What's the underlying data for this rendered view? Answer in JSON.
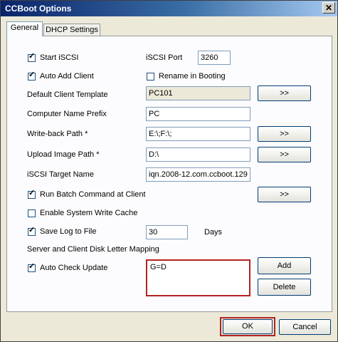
{
  "window": {
    "title": "CCBoot Options",
    "close": "✕"
  },
  "tabs": [
    {
      "label": "General"
    },
    {
      "label": "DHCP Settings"
    }
  ],
  "general": {
    "start_iscsi": {
      "label": "Start iSCSI",
      "checked": "✓"
    },
    "iscsi_port": {
      "label": "iSCSI Port",
      "value": "3260"
    },
    "auto_add_client": {
      "label": "Auto Add Client",
      "checked": "✓"
    },
    "rename_in_booting": {
      "label": "Rename in Booting",
      "checked": ""
    },
    "default_client_template": {
      "label": "Default Client Template",
      "value": "PC101",
      "button": ">>"
    },
    "computer_name_prefix": {
      "label": "Computer Name Prefix",
      "value": "PC"
    },
    "write_back_path": {
      "label": "Write-back Path *",
      "value": "E:\\;F:\\;",
      "button": ">>"
    },
    "upload_image_path": {
      "label": "Upload Image Path *",
      "value": "D:\\",
      "button": ">>"
    },
    "iscsi_target_name": {
      "label": "iSCSI Target Name",
      "value": "iqn.2008-12.com.ccboot.129"
    },
    "run_batch": {
      "label": "Run Batch Command at Client",
      "checked": "✓",
      "button": ">>"
    },
    "system_write_cache": {
      "label": "Enable System Write Cache",
      "checked": ""
    },
    "save_log": {
      "label": "Save Log to File",
      "checked": "✓",
      "value": "30",
      "unit": "Days"
    },
    "disk_letter_mapping": {
      "label": "Server and Client Disk Letter Mapping",
      "value": "G=D",
      "add": "Add",
      "delete": "Delete"
    },
    "auto_check_update": {
      "label": "Auto Check Update",
      "checked": "✓"
    }
  },
  "footer": {
    "ok": "OK",
    "cancel": "Cancel"
  },
  "colors": {
    "highlight": "#b22222",
    "title_bar": "#0a246a"
  }
}
